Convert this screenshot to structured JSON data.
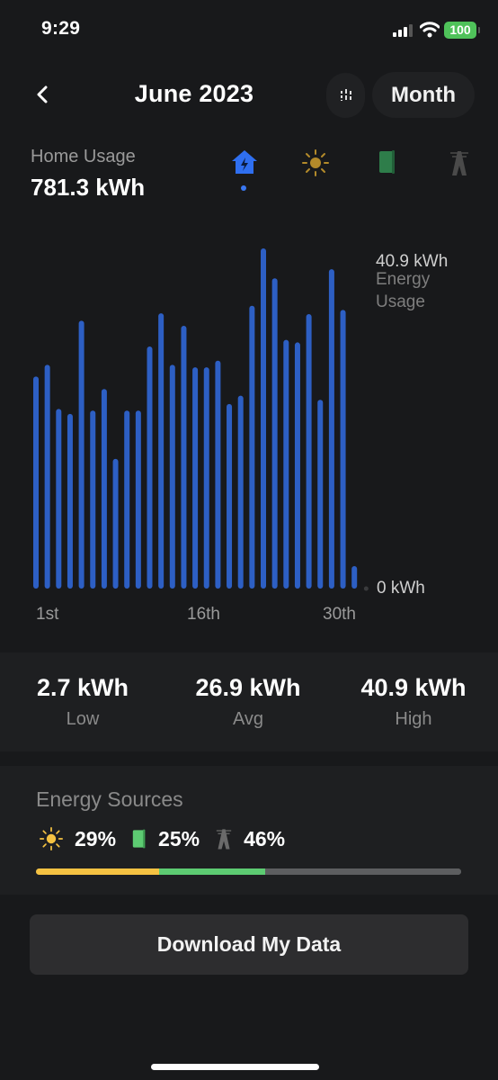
{
  "status_bar": {
    "time": "9:29",
    "battery": "100",
    "signal_bars_active": 3,
    "signal_bars_total": 4
  },
  "header": {
    "back_icon": "chevron-left-icon",
    "title": "June 2023",
    "filter_icon": "sliders-icon",
    "period_label": "Month"
  },
  "summary": {
    "label": "Home Usage",
    "value": "781.3 kWh"
  },
  "source_tabs": [
    {
      "name": "home",
      "icon": "home-bolt-icon",
      "color": "#2f6ff0",
      "active": true
    },
    {
      "name": "solar",
      "icon": "sun-icon",
      "color": "#b38a2a",
      "active": false
    },
    {
      "name": "powerwall",
      "icon": "battery-icon",
      "color": "#2e7d4a",
      "active": false
    },
    {
      "name": "grid",
      "icon": "power-tower-icon",
      "color": "#4a4a4a",
      "active": false
    }
  ],
  "chart_data": {
    "type": "bar",
    "title": "Home Usage",
    "ylabel": "Energy Usage",
    "y_max_label": "40.9 kWh",
    "y_min_label": "0 kWh",
    "ylim": [
      0,
      40.9
    ],
    "x_tick_labels": [
      {
        "day": 1,
        "label": "1st"
      },
      {
        "day": 16,
        "label": "16th"
      },
      {
        "day": 30,
        "label": "30th"
      }
    ],
    "days_in_month": 30,
    "categories": [
      1,
      2,
      3,
      4,
      5,
      6,
      7,
      8,
      9,
      10,
      11,
      12,
      13,
      14,
      15,
      16,
      17,
      18,
      19,
      20,
      21,
      22,
      23,
      24,
      25,
      26,
      27,
      28,
      29
    ],
    "values": [
      25.5,
      26.9,
      21.6,
      21.0,
      32.2,
      21.4,
      24.0,
      15.6,
      21.4,
      21.4,
      29.1,
      33.1,
      26.9,
      31.6,
      26.6,
      26.6,
      27.4,
      22.2,
      23.2,
      34.0,
      40.9,
      37.3,
      29.9,
      29.6,
      33.0,
      22.7,
      38.4,
      33.5,
      2.7
    ],
    "bar_color": "#2d5fc4",
    "empty_day_marker_color": "#3a3b3d",
    "grid": false
  },
  "stats": [
    {
      "value": "2.7 kWh",
      "label": "Low"
    },
    {
      "value": "26.9 kWh",
      "label": "Avg"
    },
    {
      "value": "40.9 kWh",
      "label": "High"
    }
  ],
  "energy_sources": {
    "title": "Energy Sources",
    "items": [
      {
        "name": "solar",
        "icon": "sun-icon",
        "percent": 29,
        "label": "29%",
        "color": "#f5c242"
      },
      {
        "name": "powerwall",
        "icon": "battery-icon",
        "percent": 25,
        "label": "25%",
        "color": "#5dcb72"
      },
      {
        "name": "grid",
        "icon": "power-tower-icon",
        "percent": 46,
        "label": "46%",
        "color": "#5d5e60"
      }
    ]
  },
  "download_button": {
    "label": "Download My Data"
  }
}
